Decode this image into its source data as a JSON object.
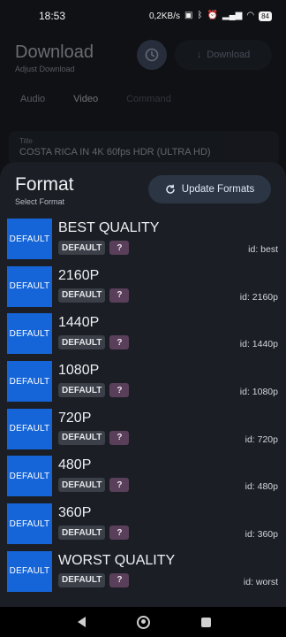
{
  "status_bar": {
    "time": "18:53",
    "net_speed": "0,2KB/s",
    "battery": "84"
  },
  "background_screen": {
    "title": "Download",
    "subtitle": "Adjust Download",
    "download_button": "Download",
    "tabs": [
      "Audio",
      "Video",
      "Command"
    ],
    "active_tab": "Video",
    "field_label": "Title",
    "field_value": "COSTA RICA IN 4K 60fps HDR (ULTRA HD)"
  },
  "sheet": {
    "title": "Format",
    "subtitle": "Select Format",
    "update_button": "Update Formats",
    "formats": [
      {
        "thumb": "DEFAULT",
        "name": "BEST QUALITY",
        "chip": "DEFAULT",
        "badge": "?",
        "id": "id: best"
      },
      {
        "thumb": "DEFAULT",
        "name": "2160P",
        "chip": "DEFAULT",
        "badge": "?",
        "id": "id: 2160p"
      },
      {
        "thumb": "DEFAULT",
        "name": "1440P",
        "chip": "DEFAULT",
        "badge": "?",
        "id": "id: 1440p"
      },
      {
        "thumb": "DEFAULT",
        "name": "1080P",
        "chip": "DEFAULT",
        "badge": "?",
        "id": "id: 1080p"
      },
      {
        "thumb": "DEFAULT",
        "name": "720P",
        "chip": "DEFAULT",
        "badge": "?",
        "id": "id: 720p"
      },
      {
        "thumb": "DEFAULT",
        "name": "480P",
        "chip": "DEFAULT",
        "badge": "?",
        "id": "id: 480p"
      },
      {
        "thumb": "DEFAULT",
        "name": "360P",
        "chip": "DEFAULT",
        "badge": "?",
        "id": "id: 360p"
      },
      {
        "thumb": "DEFAULT",
        "name": "WORST QUALITY",
        "chip": "DEFAULT",
        "badge": "?",
        "id": "id: worst"
      }
    ]
  },
  "icons": {
    "clock": "clock-icon",
    "download": "download-arrow-icon",
    "refresh": "refresh-icon"
  },
  "colors": {
    "accent_blue": "#1565d8",
    "sheet_bg": "#1b1e24",
    "button_bg": "#2c3544"
  }
}
